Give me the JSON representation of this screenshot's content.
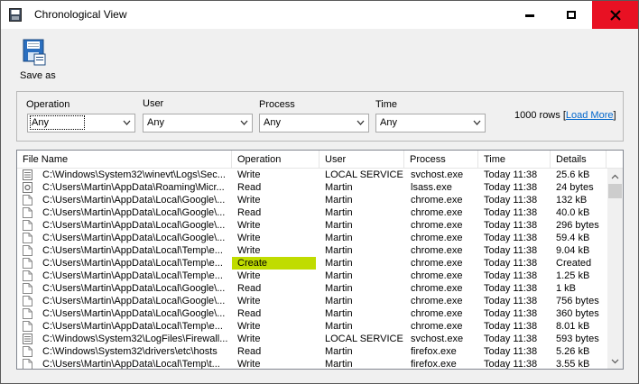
{
  "window": {
    "title": "Chronological View"
  },
  "toolbar": {
    "save_as_label": "Save as"
  },
  "filters": {
    "operation": {
      "label": "Operation",
      "value": "Any"
    },
    "user": {
      "label": "User",
      "value": "Any"
    },
    "process": {
      "label": "Process",
      "value": "Any"
    },
    "time": {
      "label": "Time",
      "value": "Any"
    },
    "row_count": "1000 rows",
    "load_more_label": "Load More"
  },
  "table": {
    "columns": [
      "File Name",
      "Operation",
      "User",
      "Process",
      "Time",
      "Details"
    ],
    "rows": [
      {
        "icon": "log-file-icon",
        "file": "C:\\Windows\\System32\\winevt\\Logs\\Sec...",
        "op": "Write",
        "user": "LOCAL SERVICE",
        "proc": "svchost.exe",
        "time": "Today 11:38",
        "det": "25.6 kB"
      },
      {
        "icon": "gear-file-icon",
        "file": "C:\\Users\\Martin\\AppData\\Roaming\\Micr...",
        "op": "Read",
        "user": "Martin",
        "proc": "lsass.exe",
        "time": "Today 11:38",
        "det": "24 bytes"
      },
      {
        "icon": "blank-file-icon",
        "file": "C:\\Users\\Martin\\AppData\\Local\\Google\\...",
        "op": "Write",
        "user": "Martin",
        "proc": "chrome.exe",
        "time": "Today 11:38",
        "det": "132 kB"
      },
      {
        "icon": "blank-file-icon",
        "file": "C:\\Users\\Martin\\AppData\\Local\\Google\\...",
        "op": "Read",
        "user": "Martin",
        "proc": "chrome.exe",
        "time": "Today 11:38",
        "det": "40.0 kB"
      },
      {
        "icon": "blank-file-icon",
        "file": "C:\\Users\\Martin\\AppData\\Local\\Google\\...",
        "op": "Write",
        "user": "Martin",
        "proc": "chrome.exe",
        "time": "Today 11:38",
        "det": "296 bytes"
      },
      {
        "icon": "blank-file-icon",
        "file": "C:\\Users\\Martin\\AppData\\Local\\Google\\...",
        "op": "Write",
        "user": "Martin",
        "proc": "chrome.exe",
        "time": "Today 11:38",
        "det": "59.4 kB"
      },
      {
        "icon": "blank-file-icon",
        "file": "C:\\Users\\Martin\\AppData\\Local\\Temp\\e...",
        "op": "Write",
        "user": "Martin",
        "proc": "chrome.exe",
        "time": "Today 11:38",
        "det": "9.04 kB"
      },
      {
        "icon": "blank-file-icon",
        "file": "C:\\Users\\Martin\\AppData\\Local\\Temp\\e...",
        "op": "Create",
        "user": "Martin",
        "proc": "chrome.exe",
        "time": "Today 11:38",
        "det": "Created",
        "highlight": true
      },
      {
        "icon": "blank-file-icon",
        "file": "C:\\Users\\Martin\\AppData\\Local\\Temp\\e...",
        "op": "Write",
        "user": "Martin",
        "proc": "chrome.exe",
        "time": "Today 11:38",
        "det": "1.25 kB"
      },
      {
        "icon": "blank-file-icon",
        "file": "C:\\Users\\Martin\\AppData\\Local\\Google\\...",
        "op": "Read",
        "user": "Martin",
        "proc": "chrome.exe",
        "time": "Today 11:38",
        "det": "1 kB"
      },
      {
        "icon": "blank-file-icon",
        "file": "C:\\Users\\Martin\\AppData\\Local\\Google\\...",
        "op": "Write",
        "user": "Martin",
        "proc": "chrome.exe",
        "time": "Today 11:38",
        "det": "756 bytes"
      },
      {
        "icon": "blank-file-icon",
        "file": "C:\\Users\\Martin\\AppData\\Local\\Google\\...",
        "op": "Read",
        "user": "Martin",
        "proc": "chrome.exe",
        "time": "Today 11:38",
        "det": "360 bytes"
      },
      {
        "icon": "blank-file-icon",
        "file": "C:\\Users\\Martin\\AppData\\Local\\Temp\\e...",
        "op": "Write",
        "user": "Martin",
        "proc": "chrome.exe",
        "time": "Today 11:38",
        "det": "8.01 kB"
      },
      {
        "icon": "log-file-icon",
        "file": "C:\\Windows\\System32\\LogFiles\\Firewall...",
        "op": "Write",
        "user": "LOCAL SERVICE",
        "proc": "svchost.exe",
        "time": "Today 11:38",
        "det": "593 bytes"
      },
      {
        "icon": "blank-file-icon",
        "file": "C:\\Windows\\System32\\drivers\\etc\\hosts",
        "op": "Read",
        "user": "Martin",
        "proc": "firefox.exe",
        "time": "Today 11:38",
        "det": "5.26 kB"
      },
      {
        "icon": "blank-file-icon",
        "file": "C:\\Users\\Martin\\AppData\\Local\\Temp\\t...",
        "op": "Write",
        "user": "Martin",
        "proc": "firefox.exe",
        "time": "Today 11:38",
        "det": "3.55 kB"
      }
    ]
  },
  "colors": {
    "close_button": "#e81123",
    "create_highlight": "#c0dc00",
    "link": "#0066cc"
  }
}
